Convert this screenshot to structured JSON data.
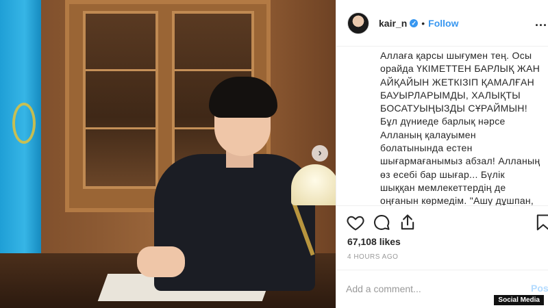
{
  "post": {
    "header": {
      "username": "kair_n",
      "separator": "•",
      "follow_label": "Follow",
      "more_label": "..."
    },
    "caption_text": "Аллаға қарсы шығумен тең. Осы орайда ҮКІМЕТТЕН БАРЛЫҚ ЖАН АЙҚАЙЫН ЖЕТКІЗІП ҚАМАЛҒАН БАУЫРЛАРЫМДЫ, ХАЛЫҚТЫ БОСАТУЫҢЫЗДЫ СҰРАЙМЫН! Бұл дүниеде барлық нәрсе Алланың қалауымен болатынында естен шығармағанымыз абзал! Алланың өз есебі бар шығар... Бүлік шыққан мемлекеттердің де оңғанын көрмедім. \"Ашу дұшпан, ақыл дос\" демекші, барлығына басқаша қарайық. Құдай қайырын берсін!",
    "likes": "67,108 likes",
    "timestamp": "4 HOURS AGO",
    "comment_placeholder": "Add a comment...",
    "post_label": "Post"
  },
  "icons": {
    "like": "heart-icon",
    "comment": "comment-icon",
    "share": "share-icon",
    "save": "bookmark-icon",
    "verified": "verified-badge-icon",
    "next": "chevron-right-icon"
  },
  "watermark": "Social Media",
  "colors": {
    "link": "#3897f0",
    "text": "#262626",
    "muted": "#999999",
    "post_disabled": "#b3dbff"
  }
}
